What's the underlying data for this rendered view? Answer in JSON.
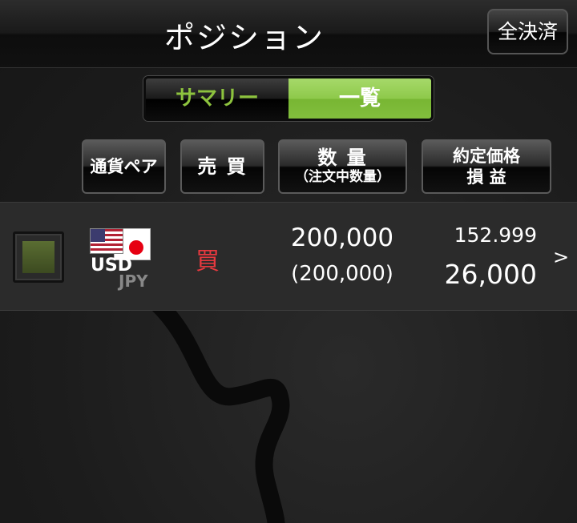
{
  "header": {
    "title": "ポジション",
    "close_all_label": "全決済"
  },
  "tabs": {
    "summary_label": "サマリー",
    "list_label": "一覧",
    "selected": "一覧"
  },
  "columns": {
    "pair_label": "通貨ペア",
    "side_label": "売 買",
    "quantity_label": "数 量",
    "quantity_sub_label": "（注文中数量）",
    "price_label": "約定価格",
    "pl_label": "損 益"
  },
  "positions": [
    {
      "base": "USD",
      "quote": "JPY",
      "side": "買",
      "quantity": "200,000",
      "order_quantity": "(200,000)",
      "price": "152.999",
      "pl": "26,000",
      "arrow": ">",
      "checked": true
    }
  ],
  "colors": {
    "accent_green": "#8dc33e",
    "buy_red": "#e8393f"
  },
  "icons": {
    "base_flag": "us-flag-icon",
    "quote_flag": "jp-flag-icon",
    "detail": "chevron-right-icon"
  }
}
